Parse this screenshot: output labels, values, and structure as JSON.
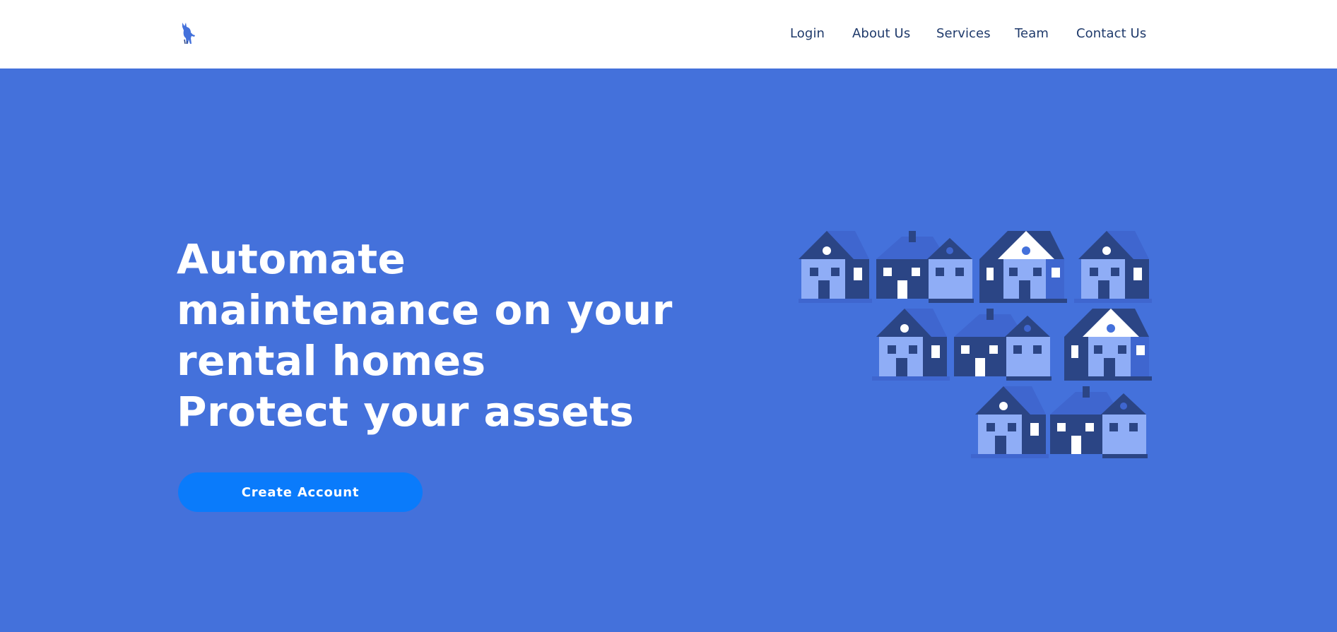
{
  "nav": {
    "logo_icon": "kangaroo-logo-icon",
    "links": [
      "Login",
      "About Us",
      "Services",
      "Team",
      "Contact Us"
    ]
  },
  "hero": {
    "headline_lines": [
      "Automate",
      "maintenance on your",
      "rental homes",
      "Protect your assets"
    ],
    "cta_label": "Create Account",
    "illustration_icon": "neighborhood-houses-illustration"
  },
  "colors": {
    "hero_background": "#4471db",
    "nav_text": "#1f3a6b",
    "cta_background": "#0a7bfb",
    "house_dark": "#2b4585",
    "house_light": "#8fadf6",
    "house_mid": "#3f66cf"
  }
}
